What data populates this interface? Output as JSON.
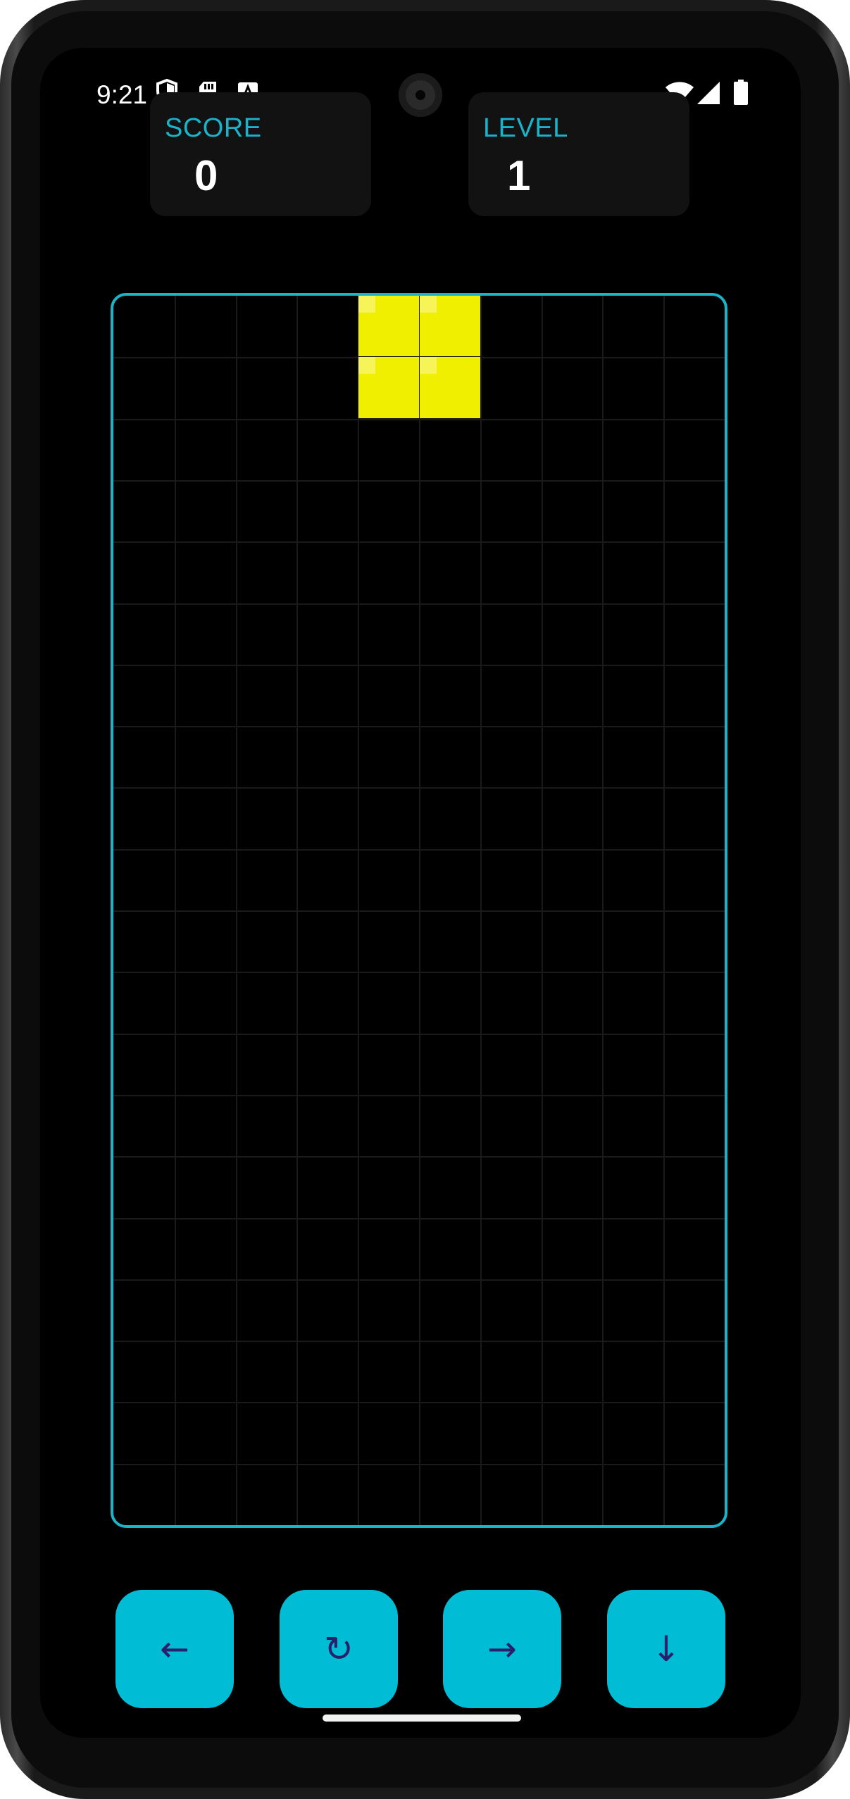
{
  "status_bar": {
    "time": "9:21",
    "left_icons": [
      "shield-icon",
      "sd-card-icon",
      "keyboard-a-icon"
    ],
    "right_icons": [
      "wifi-icon",
      "signal-icon",
      "battery-icon"
    ]
  },
  "score": {
    "label": "SCORE",
    "value": "0"
  },
  "level": {
    "label": "LEVEL",
    "value": "1"
  },
  "board": {
    "columns": 10,
    "rows": 20,
    "border_color": "#1ab3c9",
    "active_piece": {
      "type": "O",
      "color": "#f1ef00",
      "cells": [
        [
          4,
          0
        ],
        [
          5,
          0
        ],
        [
          4,
          1
        ],
        [
          5,
          1
        ]
      ]
    }
  },
  "controls": {
    "left": {
      "label": "←",
      "icon": "arrow-left-icon"
    },
    "rotate": {
      "label": "↻",
      "icon": "rotate-icon"
    },
    "right": {
      "label": "→",
      "icon": "arrow-right-icon"
    },
    "drop": {
      "label": "↓",
      "icon": "arrow-down-icon"
    }
  },
  "colors": {
    "accent": "#00bcd4",
    "button_glyph": "#2a1f6a",
    "card_background": "#121212",
    "screen_background": "#000000"
  }
}
